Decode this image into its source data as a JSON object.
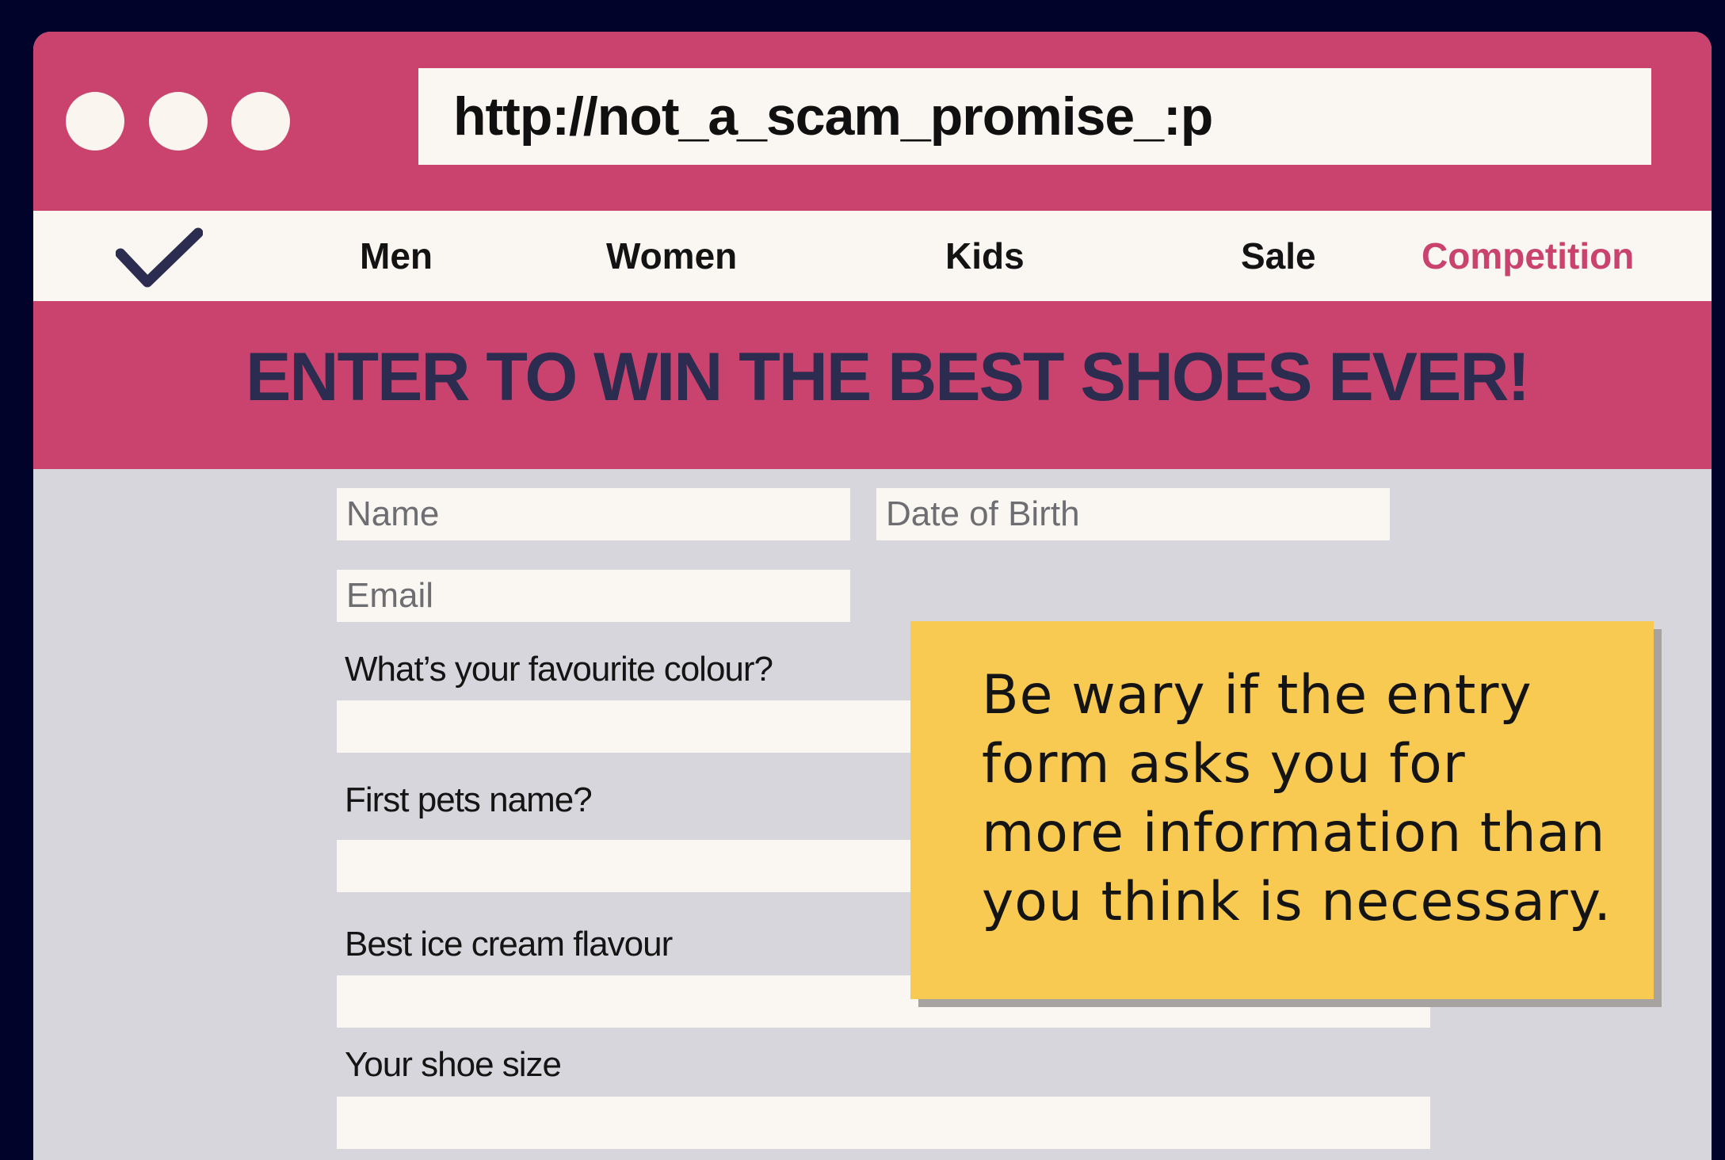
{
  "browser": {
    "url": "http://not_a_scam_promise_:p"
  },
  "nav": {
    "items": [
      {
        "label": "Men"
      },
      {
        "label": "Women"
      },
      {
        "label": "Kids"
      },
      {
        "label": "Sale"
      },
      {
        "label": "Competition",
        "active": true
      }
    ]
  },
  "hero": {
    "title": "ENTER TO WIN THE BEST SHOES EVER!"
  },
  "form": {
    "name_placeholder": "Name",
    "dob_placeholder": "Date of Birth",
    "email_placeholder": "Email",
    "questions": [
      {
        "label": "What’s your favourite colour?"
      },
      {
        "label": "First pets name?"
      },
      {
        "label": "Best ice cream flavour"
      },
      {
        "label": "Your shoe size"
      }
    ]
  },
  "note": {
    "text": "Be wary if the entry form asks you for more information than you think is necessary."
  },
  "colors": {
    "brand": "#c9436e",
    "background": "#02032a",
    "note": "#f8ca52",
    "heading": "#2c2c50"
  },
  "icons": {
    "logo": "checkmark-icon",
    "window_controls": [
      "window-dot-icon",
      "window-dot-icon",
      "window-dot-icon"
    ]
  }
}
